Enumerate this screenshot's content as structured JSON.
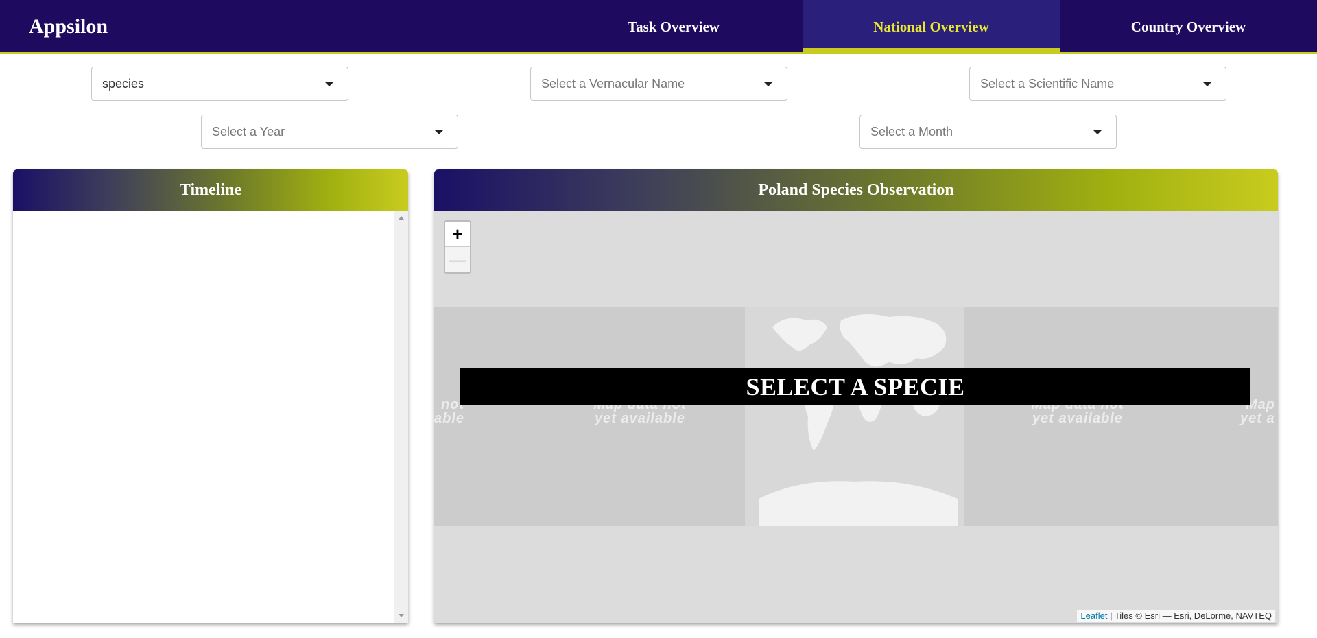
{
  "navbar": {
    "brand": "Appsilon",
    "tabs": [
      {
        "label": "Task Overview"
      },
      {
        "label": "National Overview"
      },
      {
        "label": "Country Overview"
      }
    ]
  },
  "filters": {
    "kind_select": {
      "value": "species"
    },
    "vernacular_select": {
      "placeholder": "Select a Vernacular Name"
    },
    "scientific_select": {
      "placeholder": "Select a Scientific Name"
    },
    "year_select": {
      "placeholder": "Select a Year"
    },
    "month_select": {
      "placeholder": "Select a Month"
    }
  },
  "timeline": {
    "title": "Timeline"
  },
  "map": {
    "title": "Poland Species Observation",
    "zoom_in": "+",
    "zoom_out": "—",
    "tile_message_line1": "Map data not",
    "tile_message_line2": "yet available",
    "tile_edge_left_1": "not",
    "tile_edge_left_2": "able",
    "tile_edge_right_1": "Map",
    "tile_edge_right_2": "yet a",
    "overlay_text": "SELECT A SPECIE",
    "attribution_link": "Leaflet",
    "attribution_text": " | Tiles © Esri — Esri, DeLorme, NAVTEQ"
  },
  "colors": {
    "navbar_bg": "#1e0a5f",
    "accent": "#c8cc1e",
    "active_tab_text": "#e8e832"
  }
}
